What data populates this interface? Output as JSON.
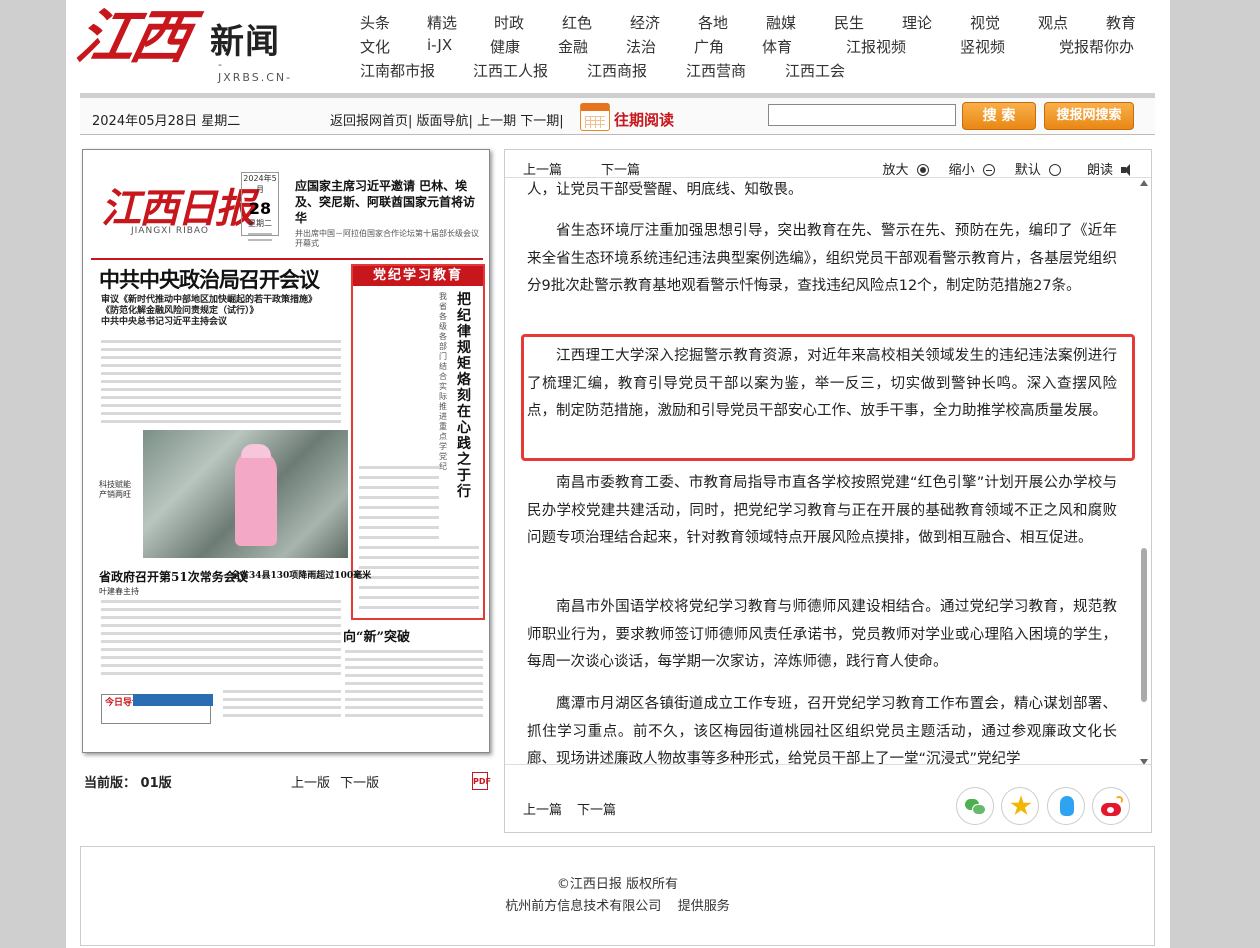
{
  "logo": {
    "script": "江西",
    "news": "新闻",
    "domain": "-JXRBS.CN-"
  },
  "nav": {
    "row1": [
      "头条",
      "精选",
      "时政",
      "红色",
      "经济",
      "各地",
      "融媒",
      "民生",
      "理论",
      "视觉",
      "观点",
      "教育"
    ],
    "row2": [
      "文化",
      "i-JX",
      "健康",
      "金融",
      "法治",
      "广角",
      "体育",
      "江报视频",
      "竖视频",
      "党报帮你办"
    ],
    "row3": [
      "江南都市报",
      "江西工人报",
      "江西商报",
      "江西营商",
      "江西工会"
    ]
  },
  "toolbar": {
    "date": "2024年05月28日 星期二",
    "links": [
      "返回报网首页|",
      "版面导航|",
      "上一期",
      "下一期|"
    ],
    "past_reading": "往期阅读",
    "search_value": "",
    "search_button": "搜 索",
    "site_search_button": "搜报网搜索"
  },
  "newspaper": {
    "logo": "江西日报",
    "subtitle": "JIANGXI RIBAO",
    "date_box": {
      "year_month": "2024年5月",
      "day": "28",
      "weekday": "星期二"
    },
    "right_head_title": "应国家主席习近平邀请 巴林、埃及、突尼斯、阿联酋国家元首将访华",
    "right_head_sub": "并出席中国－阿拉伯国家合作论坛第十届部长级会议开幕式",
    "headline": "中共中央政治局召开会议",
    "lead1": "审议《新时代推动中部地区加快崛起的若干政策措施》",
    "lead2": "《防范化解金融风险问责规定（试行）》",
    "lead3": "中共中央总书记习近平主持会议",
    "red_band": "党纪学习教育",
    "vertical_title": "把纪律规矩烙刻在心践之于行",
    "vertical_sub": "我省各级各部门结合实际推进重点学党纪",
    "side_text": "科技赋能产销两旺",
    "bottom_h1": "省政府召开第51次常务会议",
    "bottom_author": "叶建春主持",
    "bottom_h2": "全省34县130项降雨超过100毫米",
    "bottom_h3": "向“新”突破",
    "guide": "今日导读"
  },
  "pdf_panel": {
    "current_edition": "当前版：  01版",
    "prev_edition": "上一版",
    "next_edition": "下一版",
    "pdf_label": "PDF"
  },
  "article": {
    "prev": "上一篇",
    "next": "下一篇",
    "zoom_in": "放大",
    "zoom_out": "缩小",
    "default": "默认",
    "read_aloud": "朗读",
    "paragraphs": [
      "人，让党员干部受警醒、明底线、知敬畏。",
      "省生态环境厅注重加强思想引导，突出教育在先、警示在先、预防在先，编印了《近年来全省生态环境系统违纪违法典型案例选编》，组织党员干部观看警示教育片，各基层党组织分9批次赴警示教育基地观看警示忏悔录，查找违纪风险点12个，制定防范措施27条。",
      "江西理工大学深入挖掘警示教育资源，对近年来高校相关领域发生的违纪违法案例进行了梳理汇编，教育引导党员干部以案为鉴，举一反三，切实做到警钟长鸣。深入查摆风险点，制定防范措施，激励和引导党员干部安心工作、放手干事，全力助推学校高质量发展。",
      "南昌市委教育工委、市教育局指导市直各学校按照党建“红色引擎”计划开展公办学校与民办学校党建共建活动，同时，把党纪学习教育与正在开展的基础教育领域不正之风和腐败问题专项治理结合起来，针对教育领域特点开展风险点摸排，做到相互融合、相互促进。",
      "南昌市外国语学校将党纪学习教育与师德师风建设相结合。通过党纪学习教育，规范教师职业行为，要求教师签订师德师风责任承诺书，党员教师对学业或心理陷入困境的学生，每周一次谈心谈话，每学期一次家访，淬炼师德，践行育人使命。",
      "鹰潭市月湖区各镇街道成立工作专班，召开党纪学习教育工作布置会，精心谋划部署、抓住学习重点。前不久，该区梅园街道桃园社区组织党员主题活动，通过参观廉政文化长廊、现场讲述廉政人物故事等多种形式，给党员干部上了一堂“沉浸式”党纪学"
    ],
    "bottom_prev": "上一篇",
    "bottom_next": "下一篇"
  },
  "footer": {
    "copyright": "©江西日报 版权所有",
    "provider": "杭州前方信息技术有限公司    提供服务"
  },
  "colors": {
    "brand_red": "#c8161d",
    "highlight_red": "#e53935",
    "button_orange": "#e98714"
  }
}
